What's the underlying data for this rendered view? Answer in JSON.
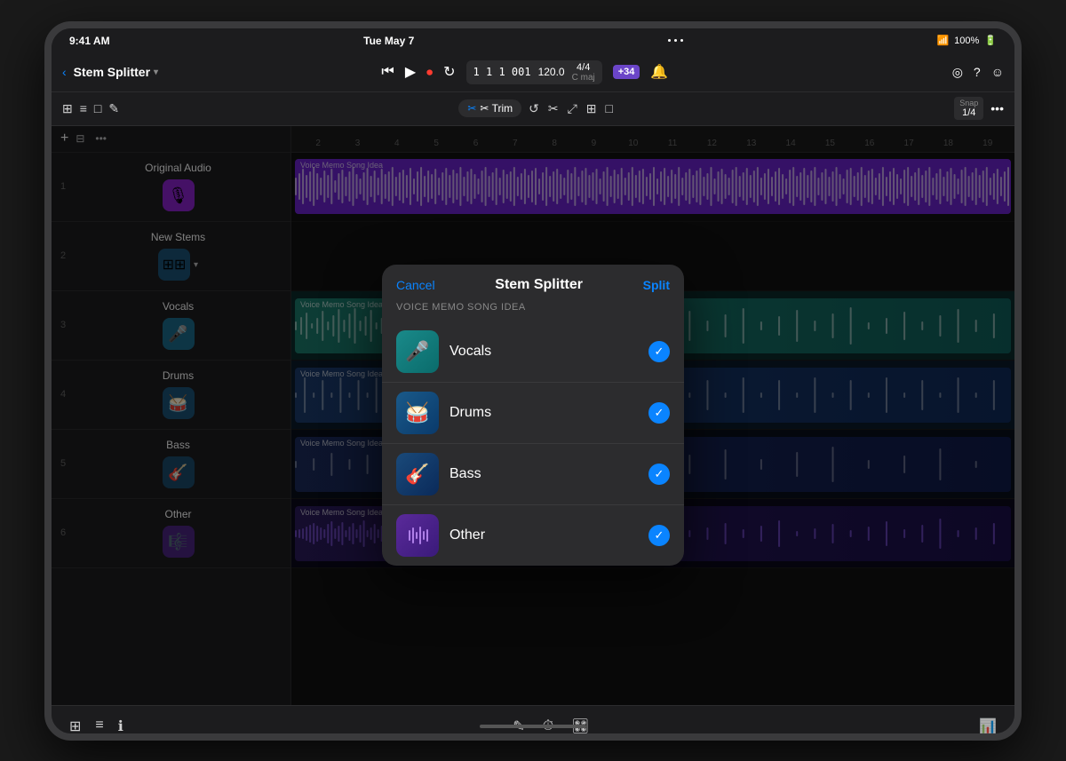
{
  "status_bar": {
    "time": "9:41 AM",
    "date": "Tue May 7",
    "battery": "100%",
    "wifi": true
  },
  "title_bar": {
    "back_label": "‹",
    "title": "Stem Splitter",
    "chevron": "▾",
    "transport": {
      "skip_back": "⏮",
      "play": "▶",
      "record": "⏺",
      "loop": "↻"
    },
    "position": "1 1 1 001",
    "bpm": "120.0",
    "time_sig": "4/4",
    "key": "C maj",
    "ai_badge": "+34",
    "icons": [
      "◎",
      "?",
      "☺"
    ]
  },
  "toolbar": {
    "left_icons": [
      "⊞",
      "≡",
      "□",
      "✎"
    ],
    "trim_label": "✂ Trim",
    "tools": [
      "↺",
      "✂",
      "⤢",
      "⊞",
      "□"
    ],
    "snap_label": "Snap",
    "snap_value": "1/4",
    "more": "•••"
  },
  "tracks": [
    {
      "num": "1",
      "name": "Original Audio",
      "icon": "🎙",
      "color": "purple",
      "clip_label": "Voice Memo Song Idea",
      "clip_color": "#6b22cc"
    },
    {
      "num": "2",
      "name": "New Stems",
      "icon": "⊞",
      "color": "teal",
      "clip_label": "",
      "clip_color": "#1a5276"
    },
    {
      "num": "3",
      "name": "Vocals",
      "icon": "🎤",
      "color": "teal",
      "clip_label": "Voice Memo Song Idea (Vocals)",
      "clip_color": "#1a7a6b"
    },
    {
      "num": "4",
      "name": "Drums",
      "icon": "🥁",
      "color": "blue",
      "clip_label": "Voice Memo Song Idea (Drums)",
      "clip_color": "#1a3a6b"
    },
    {
      "num": "5",
      "name": "Bass",
      "icon": "🎸",
      "color": "darkblue",
      "clip_label": "Voice Memo Song Idea (Bass)",
      "clip_color": "#1a2a5a"
    },
    {
      "num": "6",
      "name": "Other",
      "icon": "🎵",
      "color": "indigo",
      "clip_label": "Voice Memo Song Idea (Other)",
      "clip_color": "#2a1a6b"
    }
  ],
  "ruler_marks": [
    "2",
    "3",
    "4",
    "5",
    "6",
    "7",
    "8",
    "9",
    "10",
    "11",
    "12",
    "13",
    "14",
    "15",
    "16",
    "17",
    "18",
    "19"
  ],
  "modal": {
    "cancel_label": "Cancel",
    "title": "Stem Splitter",
    "split_label": "Split",
    "subtitle": "VOICE MEMO SONG IDEA",
    "stems": [
      {
        "name": "Vocals",
        "icon": "🎤",
        "color_class": "stem-icon-vocals",
        "checked": true
      },
      {
        "name": "Drums",
        "icon": "🥁",
        "color_class": "stem-icon-drums",
        "checked": true
      },
      {
        "name": "Bass",
        "icon": "🎸",
        "color_class": "stem-icon-bass",
        "checked": true
      },
      {
        "name": "Other",
        "icon": "🎼",
        "color_class": "stem-icon-other",
        "checked": true
      }
    ]
  },
  "bottom_bar": {
    "left_icons": [
      "⊞",
      "≡",
      "ℹ"
    ],
    "center_icons": [
      "✎",
      "⏱",
      "🎛"
    ],
    "right_icon": "📊"
  }
}
